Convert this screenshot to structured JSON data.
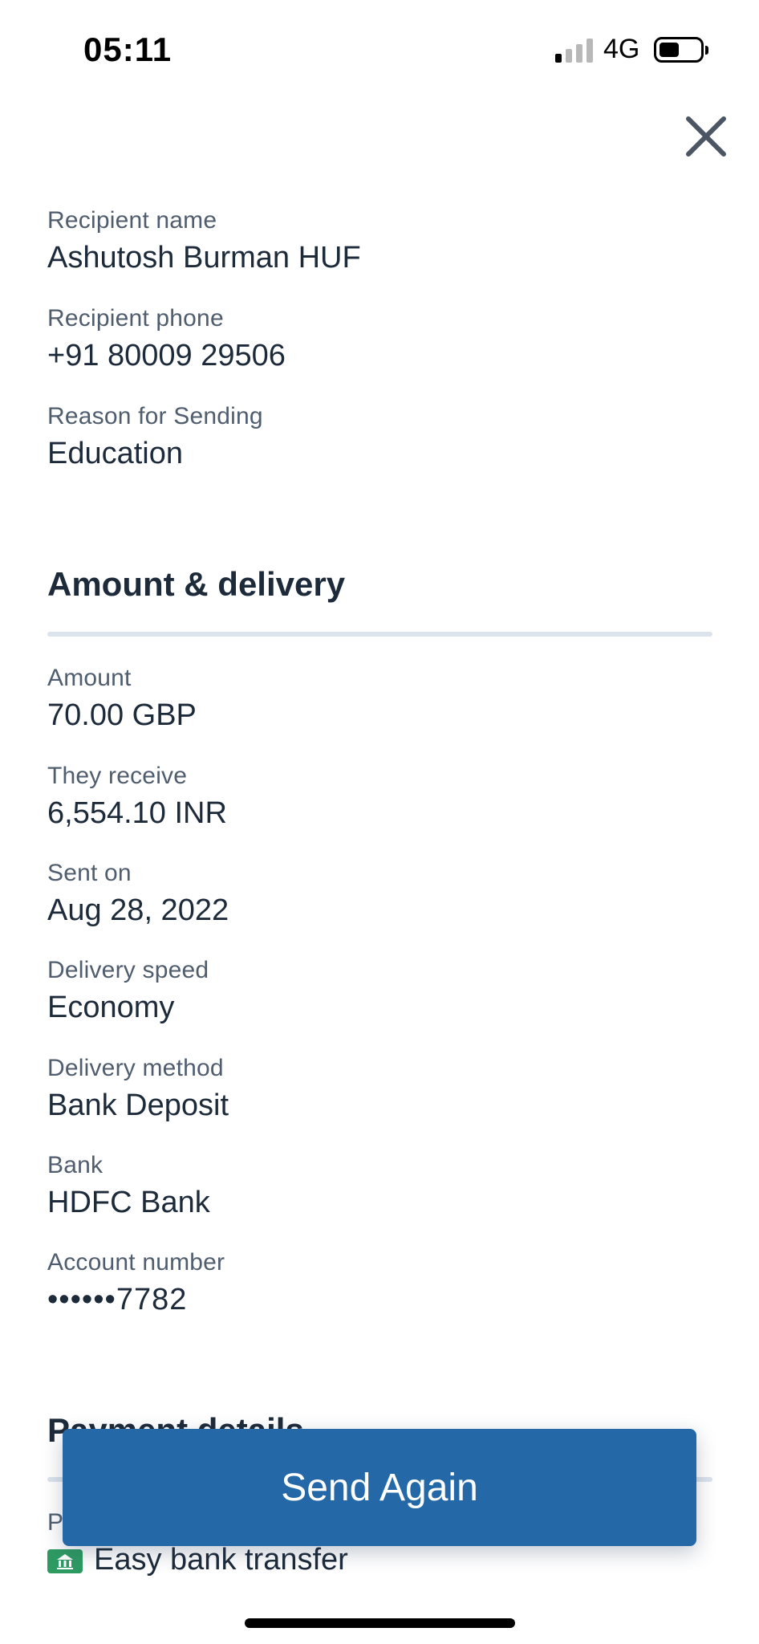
{
  "status_bar": {
    "time": "05:11",
    "network": "4G",
    "signal_bars_active": 1,
    "signal_bars_total": 4,
    "battery_level": 0.4
  },
  "icons": {
    "close": "close-icon",
    "payment_method": "bank-transfer-icon"
  },
  "recipient": {
    "fields": [
      {
        "label": "Recipient name",
        "value": "Ashutosh Burman HUF"
      },
      {
        "label": "Recipient phone",
        "value": "+91 80009 29506"
      },
      {
        "label": "Reason for Sending",
        "value": "Education"
      }
    ]
  },
  "amount_delivery": {
    "title": "Amount & delivery",
    "fields": [
      {
        "label": "Amount",
        "value": "70.00 GBP"
      },
      {
        "label": "They receive",
        "value": "6,554.10 INR"
      },
      {
        "label": "Sent on",
        "value": "Aug 28, 2022"
      },
      {
        "label": "Delivery speed",
        "value": "Economy"
      },
      {
        "label": "Delivery method",
        "value": "Bank Deposit"
      },
      {
        "label": "Bank",
        "value": "HDFC Bank"
      },
      {
        "label": "Account number",
        "value": "••••••7782"
      }
    ]
  },
  "payment_details": {
    "title": "Payment details",
    "partial_label": "P",
    "method": "Easy bank transfer"
  },
  "actions": {
    "send_again": "Send Again"
  },
  "colors": {
    "primary_button": "#2468a8",
    "text_primary": "#1c2a3a",
    "text_label": "#4f5d6e",
    "divider": "#dbe3ec",
    "payment_icon": "#2e9b63"
  }
}
